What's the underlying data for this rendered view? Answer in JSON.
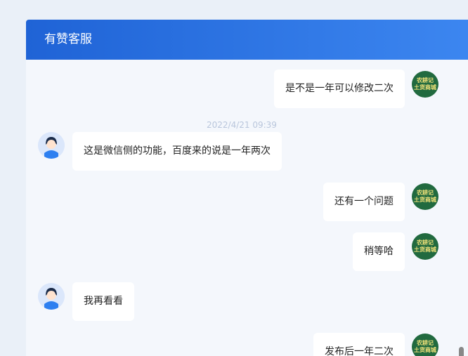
{
  "header": {
    "title": "有赞客服"
  },
  "timestamp": "2022/4/21 09:39",
  "shop_avatar": {
    "line1": "农耕记",
    "line2": "土货商城"
  },
  "messages": [
    {
      "text": "是不是一年可以修改二次"
    },
    {
      "text": "这是微信侧的功能，百度来的说是一年两次"
    },
    {
      "text": "还有一个问题"
    },
    {
      "text": "稍等哈"
    },
    {
      "text": "我再看看"
    },
    {
      "text": "发布后一年二次"
    }
  ]
}
